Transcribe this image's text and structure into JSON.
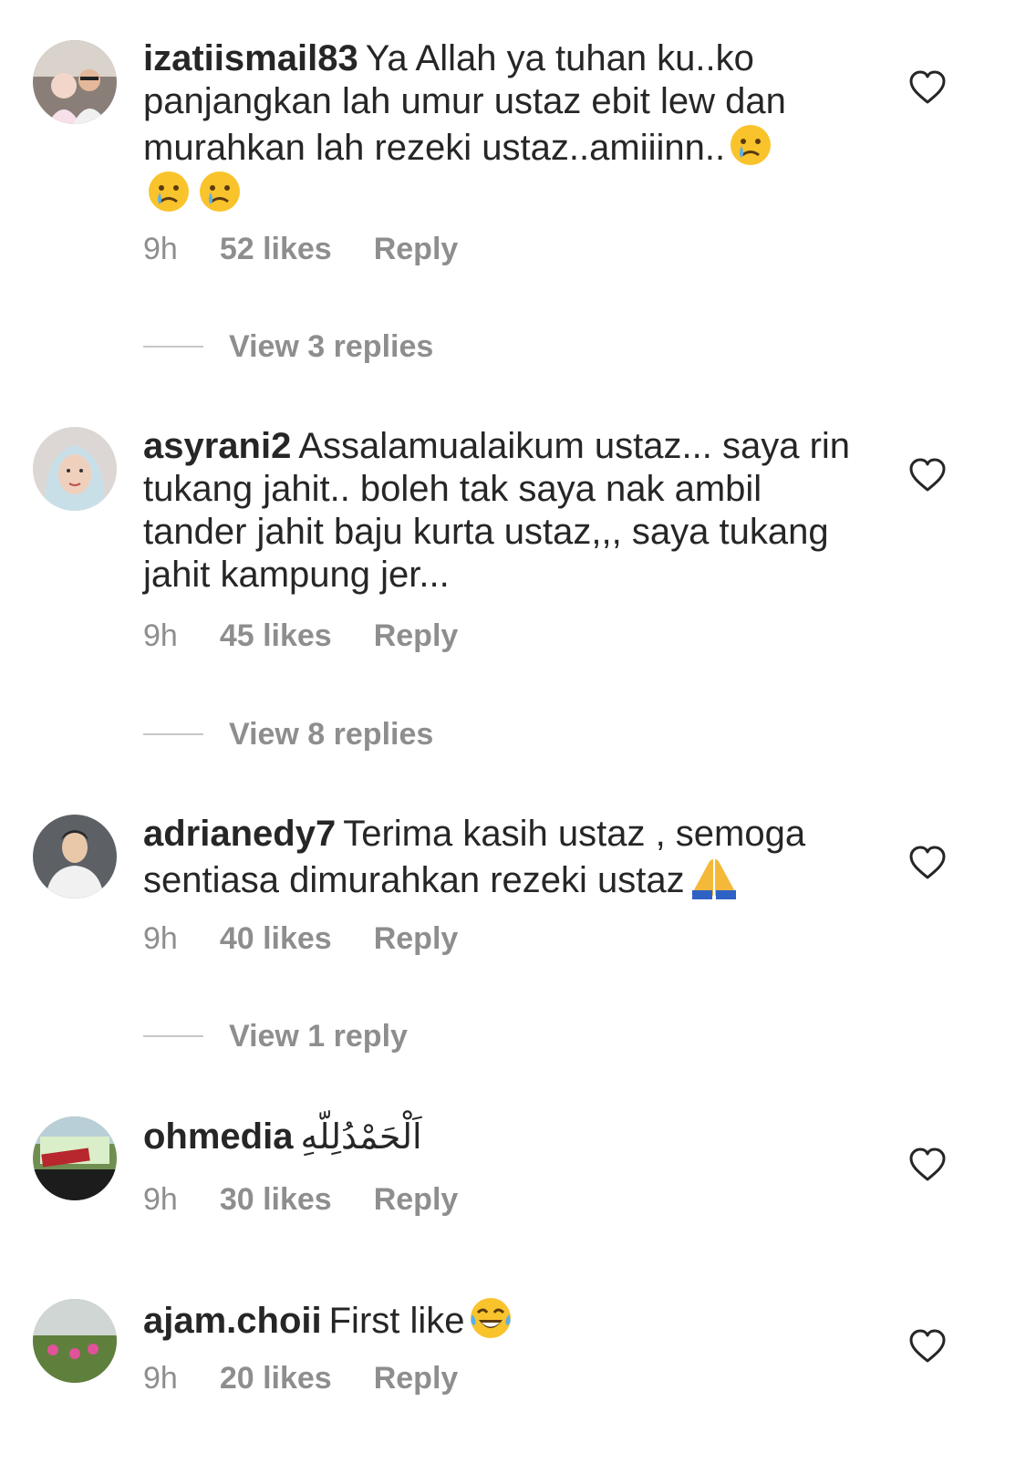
{
  "comments": [
    {
      "username": "izatiismail83",
      "text": "Ya Allah ya tuhan ku..ko panjangkan lah umur ustaz ebit lew dan murahkan lah rezeki ustaz..amiiinn..",
      "emoji_trailing": [
        "crying-face",
        "crying-face",
        "crying-face"
      ],
      "time": "9h",
      "likes": "52 likes",
      "reply": "Reply",
      "view_replies": "View 3 replies"
    },
    {
      "username": "asyrani2",
      "text": "Assalamualaikum ustaz... saya rin tukang jahit.. boleh tak saya nak ambil tander jahit baju kurta ustaz,,, saya tukang jahit kampung jer...",
      "time": "9h",
      "likes": "45 likes",
      "reply": "Reply",
      "view_replies": "View 8 replies"
    },
    {
      "username": "adrianedy7",
      "text": "Terima kasih ustaz , semoga sentiasa dimurahkan rezeki ustaz",
      "emoji_trailing": [
        "folded-hands"
      ],
      "time": "9h",
      "likes": "40 likes",
      "reply": "Reply",
      "view_replies": "View 1 reply"
    },
    {
      "username": "ohmedia",
      "text": "اَلْحَمْدُلِلّهِ",
      "time": "9h",
      "likes": "30 likes",
      "reply": "Reply"
    },
    {
      "username": "ajam.choii",
      "text": "First like",
      "emoji_trailing": [
        "tears-of-joy"
      ],
      "time": "9h",
      "likes": "20 likes",
      "reply": "Reply"
    }
  ],
  "colors": {
    "text": "#262626",
    "muted": "#8e8e8e",
    "divider": "#c7c7c7"
  }
}
